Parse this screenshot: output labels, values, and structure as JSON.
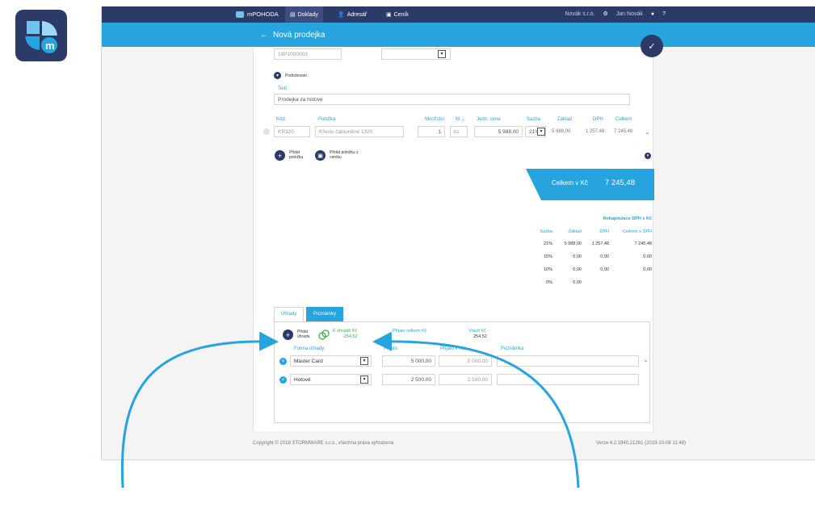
{
  "topbar": {
    "app_name": "mPOHODA",
    "nav": [
      {
        "label": "Doklady",
        "icon": "documents-icon",
        "active": true
      },
      {
        "label": "Adresář",
        "icon": "person-icon",
        "active": false
      },
      {
        "label": "Ceník",
        "icon": "pricelist-icon",
        "active": false
      }
    ],
    "company": "Novák s.r.o.",
    "user": "Jan Novák"
  },
  "page": {
    "title": "Nová prodejka",
    "doc_number": "19P1000003"
  },
  "details": {
    "toggle_label": "Podrobnosti",
    "text_label": "Text",
    "text_value": "Prodejka za hotové"
  },
  "items_table": {
    "headers": {
      "code": "Kód",
      "item": "Položka",
      "qty": "Množství",
      "unit": "M. j.",
      "unit_price": "Jedn. cena",
      "rate": "Sazba",
      "base": "Základ",
      "vat": "DPH",
      "total": "Celkem"
    },
    "rows": [
      {
        "code": "KR320",
        "item": "Křeslo čalouněné 1320",
        "qty": "1",
        "unit": "ks",
        "unit_price": "5 988,00",
        "rate": "21%",
        "base": "5 988,00",
        "vat": "1 257,48",
        "total": "7 245,48"
      }
    ]
  },
  "actions": {
    "add_item": "Přidat položku",
    "add_item_from_pricelist": "Přidat položku z ceníku"
  },
  "total": {
    "label": "Celkem v Kč",
    "value": "7 245,48"
  },
  "vat_recap": {
    "title": "Rekapitulace DPH v Kč",
    "headers": [
      "Sazba",
      "Základ",
      "DPH",
      "Celkem s DPH"
    ],
    "rows": [
      [
        "21%",
        "5 988,00",
        "1 257,48",
        "7 245,48"
      ],
      [
        "15%",
        "0,00",
        "0,00",
        "0,00"
      ],
      [
        "10%",
        "0,00",
        "0,00",
        "0,00"
      ],
      [
        "0%",
        "0,00",
        "",
        ""
      ]
    ]
  },
  "tabs": [
    {
      "label": "Úhrady",
      "active": false
    },
    {
      "label": "Poznámky",
      "active": true
    }
  ],
  "payments": {
    "add_payment": "Přidat úhradu",
    "to_pay_label": "K úhradě Kč",
    "to_pay_value": "-254,52",
    "received_total_label": "Přijato celkem Kč",
    "received_total_value": "",
    "change_label": "Vrácit Kč",
    "change_value": "254,52",
    "headers": {
      "method": "Forma úhrady",
      "received": "Přijato",
      "received_czk": "Přijato v Kč",
      "note": "Poznámka"
    },
    "rows": [
      {
        "method": "Master Card",
        "received": "5 000,00",
        "received_czk": "5 000,00",
        "note": ""
      },
      {
        "method": "Hotově",
        "received": "2 500,00",
        "received_czk": "2 500,00",
        "note": ""
      }
    ]
  },
  "footer": {
    "copyright": "Copyright © 2019 STORMWARE s.r.o., všechna práva vyhrazena",
    "version": "Verze 4.2.1940.21261 (2019-10-08 11:48)"
  },
  "colors": {
    "navy": "#2b3a67",
    "accent": "#27a3de",
    "green": "#3fae49"
  }
}
